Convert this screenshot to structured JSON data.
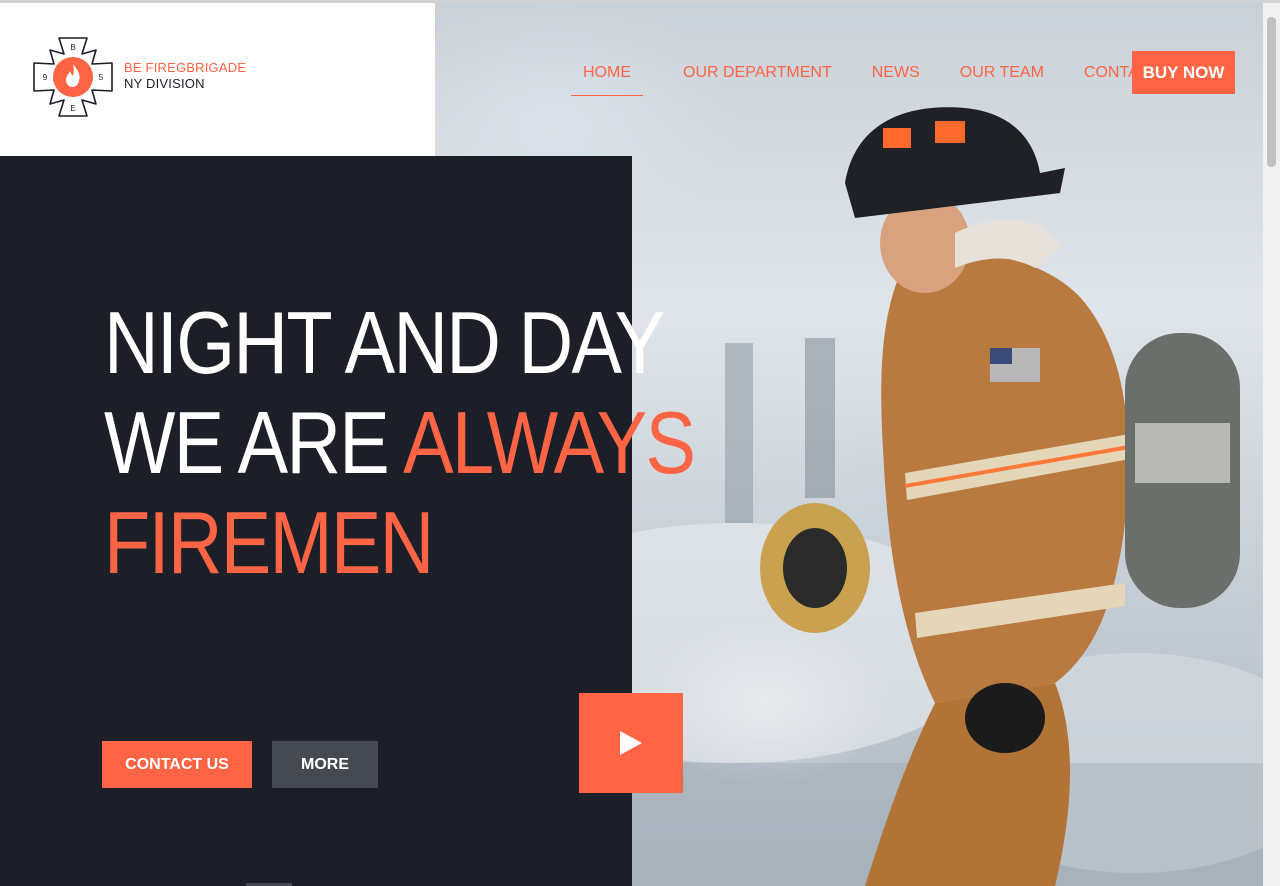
{
  "brand": {
    "line1": "BE FIREGBRIGADE",
    "line2": "NY DIVISION",
    "emblem_letters": [
      "B",
      "9",
      "5",
      "E"
    ],
    "icon": "flame-icon"
  },
  "nav": {
    "items": [
      {
        "label": "HOME",
        "active": true
      },
      {
        "label": "OUR DEPARTMENT",
        "active": false
      },
      {
        "label": "NEWS",
        "active": false
      },
      {
        "label": "OUR TEAM",
        "active": false
      },
      {
        "label": "CONTACT",
        "active": false
      }
    ],
    "cta_label": "BUY NOW"
  },
  "hero": {
    "line1": "NIGHT AND DAY",
    "line2_white": "WE ARE ",
    "line2_accent": "ALWAYS",
    "line3": "FIREMEN",
    "contact_label": "CONTACT US",
    "more_label": "MORE",
    "play_icon": "play-icon",
    "image_description_icon": "firefighter-photo"
  },
  "colors": {
    "accent": "#ff6445",
    "dark": "#1c1f27",
    "secondary_button": "#454952"
  }
}
